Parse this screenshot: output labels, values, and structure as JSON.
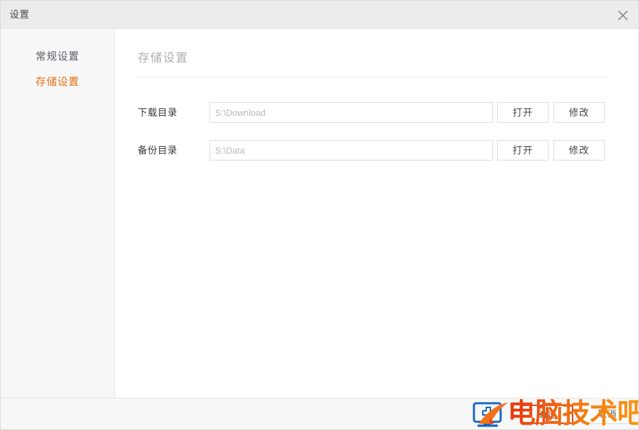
{
  "window": {
    "title": "设置",
    "close_icon": "close-icon"
  },
  "sidebar": {
    "items": [
      {
        "label": "常规设置",
        "active": false
      },
      {
        "label": "存储设置",
        "active": true
      }
    ]
  },
  "content": {
    "heading": "存储设置",
    "rows": [
      {
        "label": "下载目录",
        "value": "",
        "placeholder": "S:\\Download",
        "open_label": "打开",
        "modify_label": "修改"
      },
      {
        "label": "备份目录",
        "value": "",
        "placeholder": "S:\\Data",
        "open_label": "打开",
        "modify_label": "修改"
      }
    ]
  },
  "footer": {
    "confirm_label": "确定",
    "cancel_label": "取消"
  },
  "watermark": {
    "text": "电脑技术吧",
    "logo_icon": "monitor-cross-logo-icon"
  },
  "colors": {
    "accent_orange": "#e8700f",
    "titlebar_bg": "#ececec",
    "sidebar_bg": "#f7f7f7",
    "border": "#dcdcdc",
    "heading_gray": "#aeaeae",
    "confirm_border_red": "#e23b2c"
  }
}
